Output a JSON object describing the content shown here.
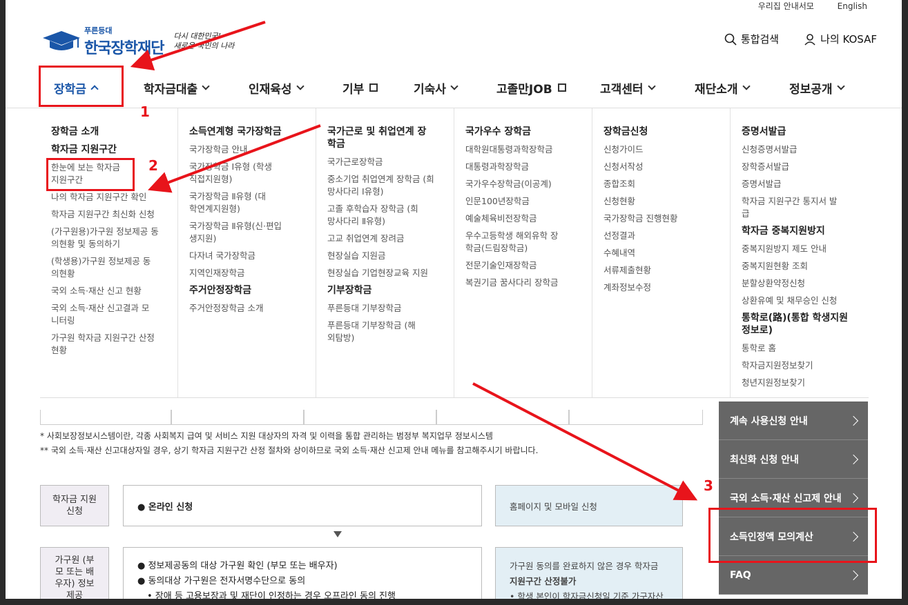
{
  "util": {
    "links": [
      "우리집 안내서모",
      "English"
    ]
  },
  "logo": {
    "small": "푸른등대",
    "main": "한국장학재단",
    "slogan_line1": "다시 대한민국!",
    "slogan_line2": "새로운 국민의 나라"
  },
  "header": {
    "search": "통합검색",
    "my": "나의 KOSAF"
  },
  "gnb": [
    "장학금",
    "학자금대출",
    "인재육성",
    "기부",
    "기숙사",
    "고졸만JOB",
    "고객센터",
    "재단소개",
    "정보공개"
  ],
  "mega": {
    "col1": [
      "장학금 소개",
      "학자금 지원구간",
      "한눈에 보는 학자금 지원구간",
      "나의 학자금 지원구간 확인",
      "학자금 지원구간 최신화 신청",
      "(가구원용)가구원 정보제공 동의현황 및 동의하기",
      "(학생용)가구원 정보제공 동의현황",
      "국외 소득·재산 신고 현황",
      "국외 소득·재산 신고결과 모니터링",
      "가구원 학자금 지원구간 산정 현황"
    ],
    "col2": [
      "소득연계형 국가장학금",
      "국가장학금 안내",
      "국가장학금 Ⅰ유형 (학생직접지원형)",
      "국가장학금 Ⅱ유형 (대학연계지원형)",
      "국가장학금 Ⅱ유형(신·편입생지원)",
      "다자녀 국가장학금",
      "지역인재장학금",
      "주거안정장학금",
      "주거안정장학금 소개"
    ],
    "col3": [
      "국가근로 및 취업연계 장학금",
      "국가근로장학금",
      "중소기업 취업연계 장학금 (희망사다리 Ⅰ유형)",
      "고졸 후학습자 장학금 (희망사다리 Ⅱ유형)",
      "고교 취업연계 장려금",
      "현장실습 지원금",
      "현장실습 기업현장교육 지원",
      "기부장학금",
      "푸른등대 기부장학금",
      "푸른등대 기부장학금 (해외탐방)"
    ],
    "col4": [
      "국가우수 장학금",
      "대학원대통령과학장학금",
      "대통령과학장학금",
      "국가우수장학금(이공계)",
      "인문100년장학금",
      "예술체육비전장학금",
      "우수고등학생 해외유학 장학금(드림장학금)",
      "전문기술인재장학금",
      "복권기금 꿈사다리 장학금"
    ],
    "col5": [
      "장학금신청",
      "신청가이드",
      "신청서작성",
      "종합조회",
      "신청현황",
      "국가장학금 진행현황",
      "선정결과",
      "수혜내역",
      "서류제출현황",
      "계좌정보수정"
    ],
    "col6": [
      "증명서발급",
      "신청증명서발급",
      "장학증서발급",
      "증명서발급",
      "학자금 지원구간 통지서 발급",
      "학자금 중복지원방지",
      "중복지원방지 제도 안내",
      "중복지원현황 조회",
      "분할상환약정신청",
      "상환유예 및 채무승인 신청",
      "통학로(路)(통합 학생지원 정보로)",
      "통학로 홈",
      "학자금지원정보찾기",
      "청년지원정보찾기"
    ]
  },
  "notes": [
    "* 사회보장정보시스템이란, 각종 사회복지 급여 및 서비스 지원 대상자의 자격 및 이력을 통합 관리하는 범정부 복지업무 정보시스템",
    "** 국외 소득·재산 신고대상자일 경우, 상기 학자금 지원구간 산정 절차와 상이하므로 국외 소득·재산 신고제 안내 메뉴를 참고해주시기 바랍니다."
  ],
  "flow": {
    "step1_label": "학자금 지원 신청",
    "step1_text": "● 온라인 신청",
    "step1_note": "홈페이지 및 모바일 신청",
    "step2_label": "가구원 (부모 또는 배우자) 정보제공",
    "step2_line1": "● 정보제공동의 대상 가구원 확인 (부모 또는 배우자)",
    "step2_line2": "● 동의대상 가구원은 전자서명수단으로 동의",
    "step2_line3": "• 장애 등 고용보장과 및 재단이 인정하는 경우 오프라인 동의 진행",
    "step2_note1": "가구원 동의를 완료하지 않은 경우 학자금",
    "step2_note2": "지원구간 산정불가",
    "step2_note3": "• 학생 본인이 학자금신청일 기준 가구자산원"
  },
  "side": [
    "계속 사용신청 안내",
    "최신화 신청 안내",
    "국외 소득·재산 신고제 안내",
    "소득인정액 모의계산",
    "FAQ"
  ],
  "annotations": [
    "1",
    "2",
    "3"
  ]
}
